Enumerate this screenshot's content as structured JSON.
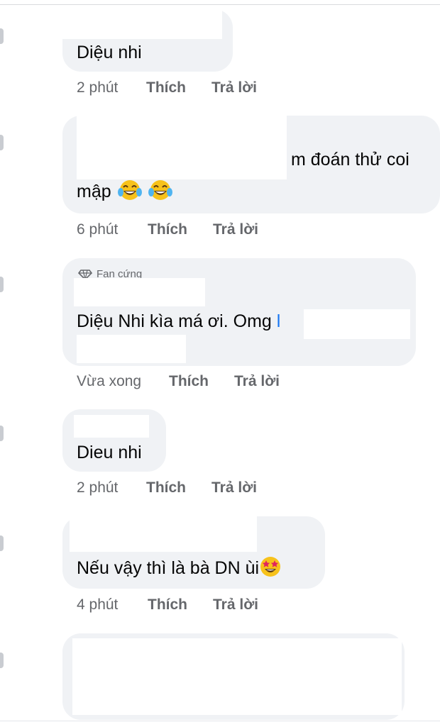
{
  "comments": [
    {
      "text": "Diệu  nhi",
      "time": "2 phút",
      "like": "Thích",
      "reply": "Trả lời"
    },
    {
      "text_line1": "m đoán thử coi",
      "text_line2": "mập",
      "emoji": "tears-of-joy-emoji",
      "time": "6 phút",
      "like": "Thích",
      "reply": "Trả lời"
    },
    {
      "badge": "Fan cứng",
      "badge_icon": "diamond-icon",
      "text": "Diệu Nhi kìa má ơi. Omg",
      "mention_fragment": "l",
      "time": "Vừa xong",
      "like": "Thích",
      "reply": "Trả lời"
    },
    {
      "text": "Dieu nhi",
      "time": "2 phút",
      "like": "Thích",
      "reply": "Trả lời"
    },
    {
      "text": "Nếu vậy thì là bà DN ùi",
      "emoji": "star-struck-emoji",
      "time": "4 phút",
      "like": "Thích",
      "reply": "Trả lời"
    }
  ],
  "colors": {
    "bubble": "#f0f2f5",
    "meta": "#65676b",
    "mention": "#1877f2",
    "emoji": "#f7c21b"
  }
}
